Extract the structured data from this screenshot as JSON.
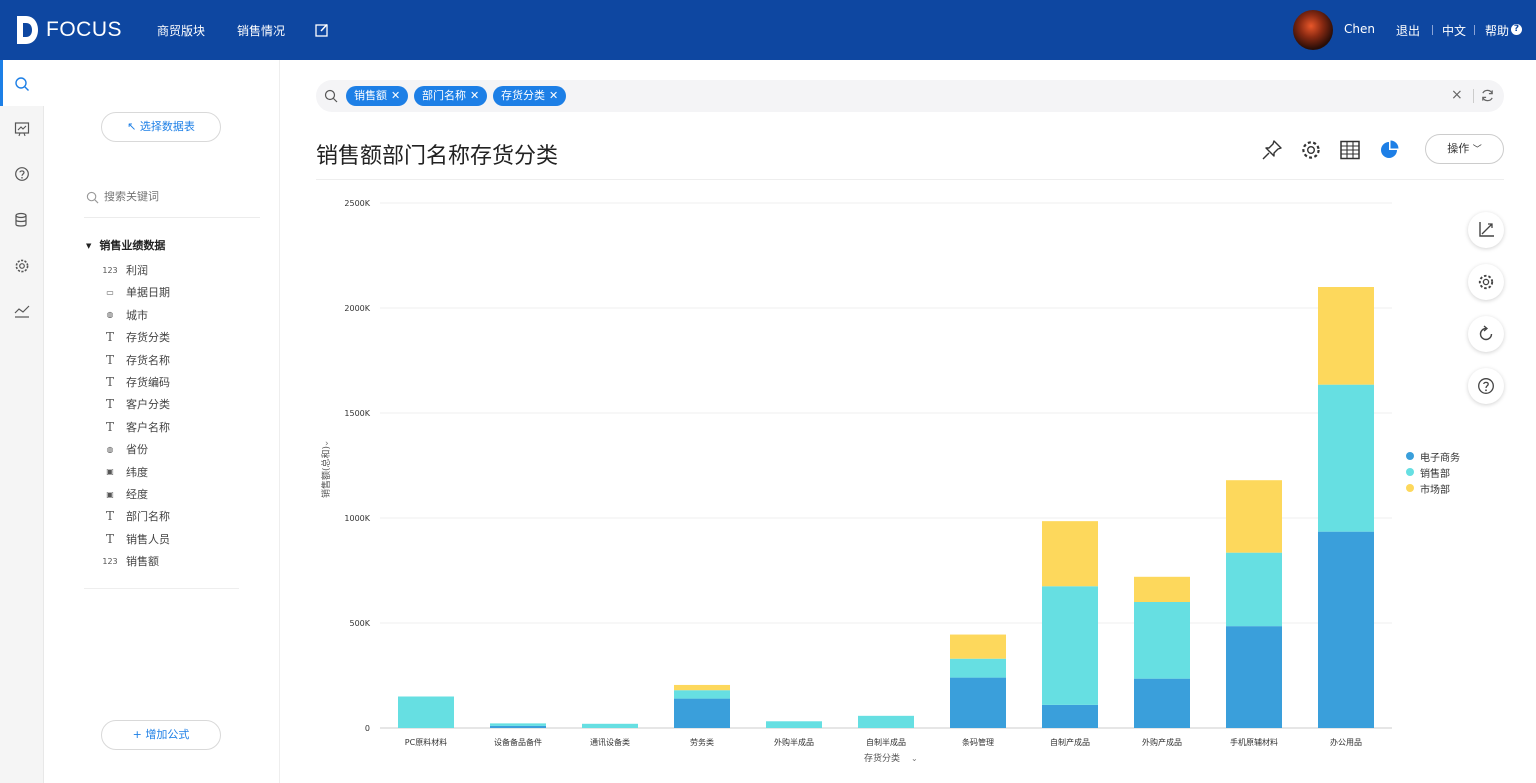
{
  "app": {
    "logo_text": "FOCUS"
  },
  "nav": {
    "items": [
      {
        "label": "商贸版块"
      },
      {
        "label": "销售情况"
      }
    ]
  },
  "user": {
    "name": "Chen",
    "logout": "退出",
    "language": "中文",
    "help": "帮助",
    "help_icon": "?"
  },
  "sidebar": {
    "select_table": "↖ 选择数据表",
    "search_placeholder": "搜索关键词",
    "dataset": "销售业绩数据",
    "fields": [
      {
        "label": "利润",
        "icon": "number-icon"
      },
      {
        "label": "单据日期",
        "icon": "calendar-icon"
      },
      {
        "label": "城市",
        "icon": "globe-icon"
      },
      {
        "label": "存货分类",
        "icon": "text-icon"
      },
      {
        "label": "存货名称",
        "icon": "text-icon"
      },
      {
        "label": "存货编码",
        "icon": "text-icon"
      },
      {
        "label": "客户分类",
        "icon": "text-icon"
      },
      {
        "label": "客户名称",
        "icon": "text-icon"
      },
      {
        "label": "省份",
        "icon": "globe-icon"
      },
      {
        "label": "纬度",
        "icon": "map-icon"
      },
      {
        "label": "经度",
        "icon": "map-icon"
      },
      {
        "label": "部门名称",
        "icon": "text-icon"
      },
      {
        "label": "销售人员",
        "icon": "text-icon"
      },
      {
        "label": "销售额",
        "icon": "number-icon"
      }
    ],
    "add_formula": "+ 增加公式"
  },
  "search": {
    "chips": [
      "销售额",
      "部门名称",
      "存货分类"
    ],
    "clear": "×"
  },
  "main": {
    "title": "销售额部门名称存货分类",
    "operations": "操作"
  },
  "colors": {
    "accent": "#1d7fe6",
    "topbar": "#0e47a1",
    "series": [
      "#3a9fdb",
      "#66dfe2",
      "#fdd85c"
    ]
  },
  "chart_data": {
    "type": "bar",
    "stacked": true,
    "categories": [
      "PC原料材料",
      "设备备品备件",
      "通讯设备类",
      "劳务类",
      "外购半成品",
      "自制半成品",
      "条码管理",
      "自制产成品",
      "外购产成品",
      "手机原辅材料",
      "办公用品"
    ],
    "series": [
      {
        "name": "电子商务",
        "values": [
          0,
          10000,
          0,
          140000,
          0,
          0,
          240000,
          110000,
          235000,
          485000,
          935000
        ]
      },
      {
        "name": "销售部",
        "values": [
          150000,
          12000,
          20000,
          40000,
          32000,
          58000,
          90000,
          565000,
          365000,
          350000,
          700000
        ]
      },
      {
        "name": "市场部",
        "values": [
          0,
          0,
          0,
          25000,
          0,
          0,
          115000,
          310000,
          120000,
          345000,
          465000
        ]
      }
    ],
    "xlabel": "存货分类",
    "ylabel": "销售额(总和)",
    "yticks": [
      "0",
      "500K",
      "1000K",
      "1500K",
      "2000K",
      "2500K"
    ],
    "ylim": [
      0,
      2500000
    ],
    "grid": true,
    "legend": "right"
  }
}
